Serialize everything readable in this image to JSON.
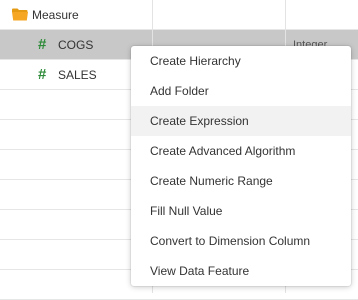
{
  "tree": {
    "folder": {
      "label": "Measure",
      "icon": "folder-icon"
    },
    "fields": [
      {
        "label": "COGS",
        "type": "Integer",
        "icon": "hash-icon",
        "selected": true
      },
      {
        "label": "SALES",
        "icon": "hash-icon",
        "selected": false
      }
    ],
    "hash_glyph": "#"
  },
  "context_menu": {
    "items": [
      {
        "label": "Create Hierarchy"
      },
      {
        "label": "Add Folder"
      },
      {
        "label": "Create Expression",
        "hovered": true
      },
      {
        "label": "Create Advanced Algorithm"
      },
      {
        "label": "Create Numeric Range"
      },
      {
        "label": "Fill Null Value"
      },
      {
        "label": "Convert to Dimension Column"
      },
      {
        "label": "View Data Feature"
      }
    ]
  },
  "colors": {
    "selected_row": "#c8c8c8",
    "hash_icon": "#2e8b3a",
    "folder_icon": "#f5a623",
    "menu_hover": "#f2f2f2"
  }
}
